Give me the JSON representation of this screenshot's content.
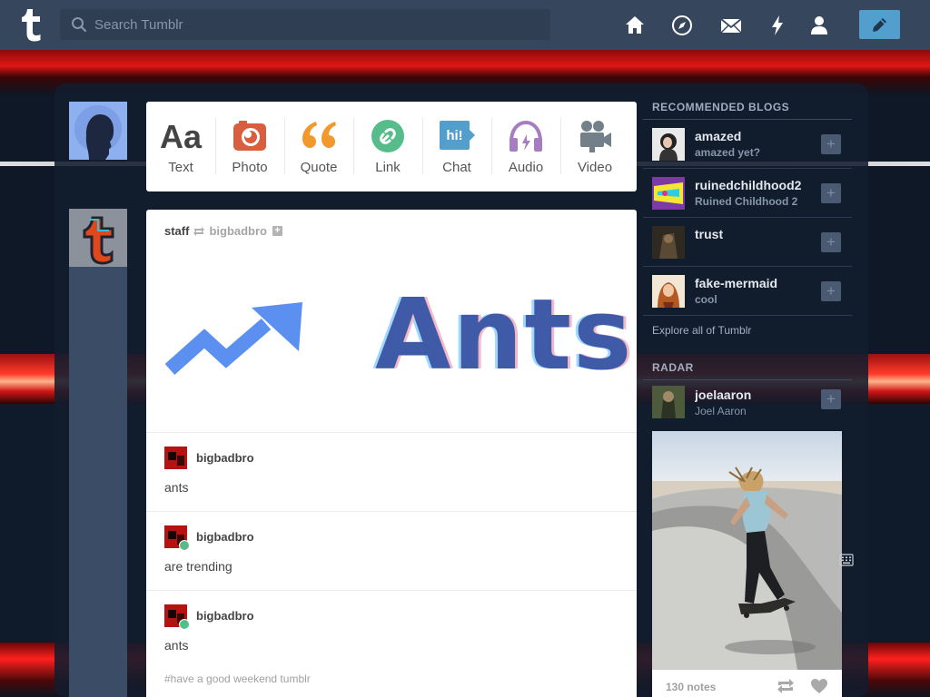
{
  "search": {
    "placeholder": "Search Tumblr"
  },
  "nav": {
    "home": "home-icon",
    "explore": "compass-icon",
    "inbox": "mail-icon",
    "activity": "lightning-icon",
    "account": "person-icon",
    "compose": "pencil-icon"
  },
  "post_types": [
    {
      "label": "Text",
      "icon": "text-icon",
      "color": "#444444"
    },
    {
      "label": "Photo",
      "icon": "camera-icon",
      "color": "#d95e40"
    },
    {
      "label": "Quote",
      "icon": "quote-icon",
      "color": "#f2992e"
    },
    {
      "label": "Link",
      "icon": "link-icon",
      "color": "#56bc8a"
    },
    {
      "label": "Chat",
      "icon": "chat-icon",
      "color": "#529ecc"
    },
    {
      "label": "Audio",
      "icon": "headphones-icon",
      "color": "#a77dc2"
    },
    {
      "label": "Video",
      "icon": "video-camera-icon",
      "color": "#748089"
    }
  ],
  "chat_icon_text": "hi!",
  "post": {
    "author": "staff",
    "reblogged_from": "bigbadbro",
    "hero_text": "Ants",
    "entries": [
      {
        "name": "bigbadbro",
        "text": "ants"
      },
      {
        "name": "bigbadbro",
        "text": "are trending"
      },
      {
        "name": "bigbadbro",
        "text": "ants"
      }
    ],
    "tags": "#have a good weekend tumblr"
  },
  "sidebar": {
    "recommended_title": "RECOMMENDED BLOGS",
    "blogs": [
      {
        "name": "amazed",
        "subtitle": "amazed yet?"
      },
      {
        "name": "ruinedchildhood2",
        "subtitle": "Ruined Childhood 2"
      },
      {
        "name": "trust",
        "subtitle": ""
      },
      {
        "name": "fake-mermaid",
        "subtitle": "cool"
      }
    ],
    "explore_link": "Explore all of Tumblr",
    "radar_title": "RADAR",
    "radar": {
      "name": "joelaaron",
      "subtitle": "Joel Aaron",
      "notes": "130 notes"
    }
  },
  "colors": {
    "topbar": "#36465d",
    "compose": "#529ecc",
    "sidebar_text": "#a1adbf"
  }
}
